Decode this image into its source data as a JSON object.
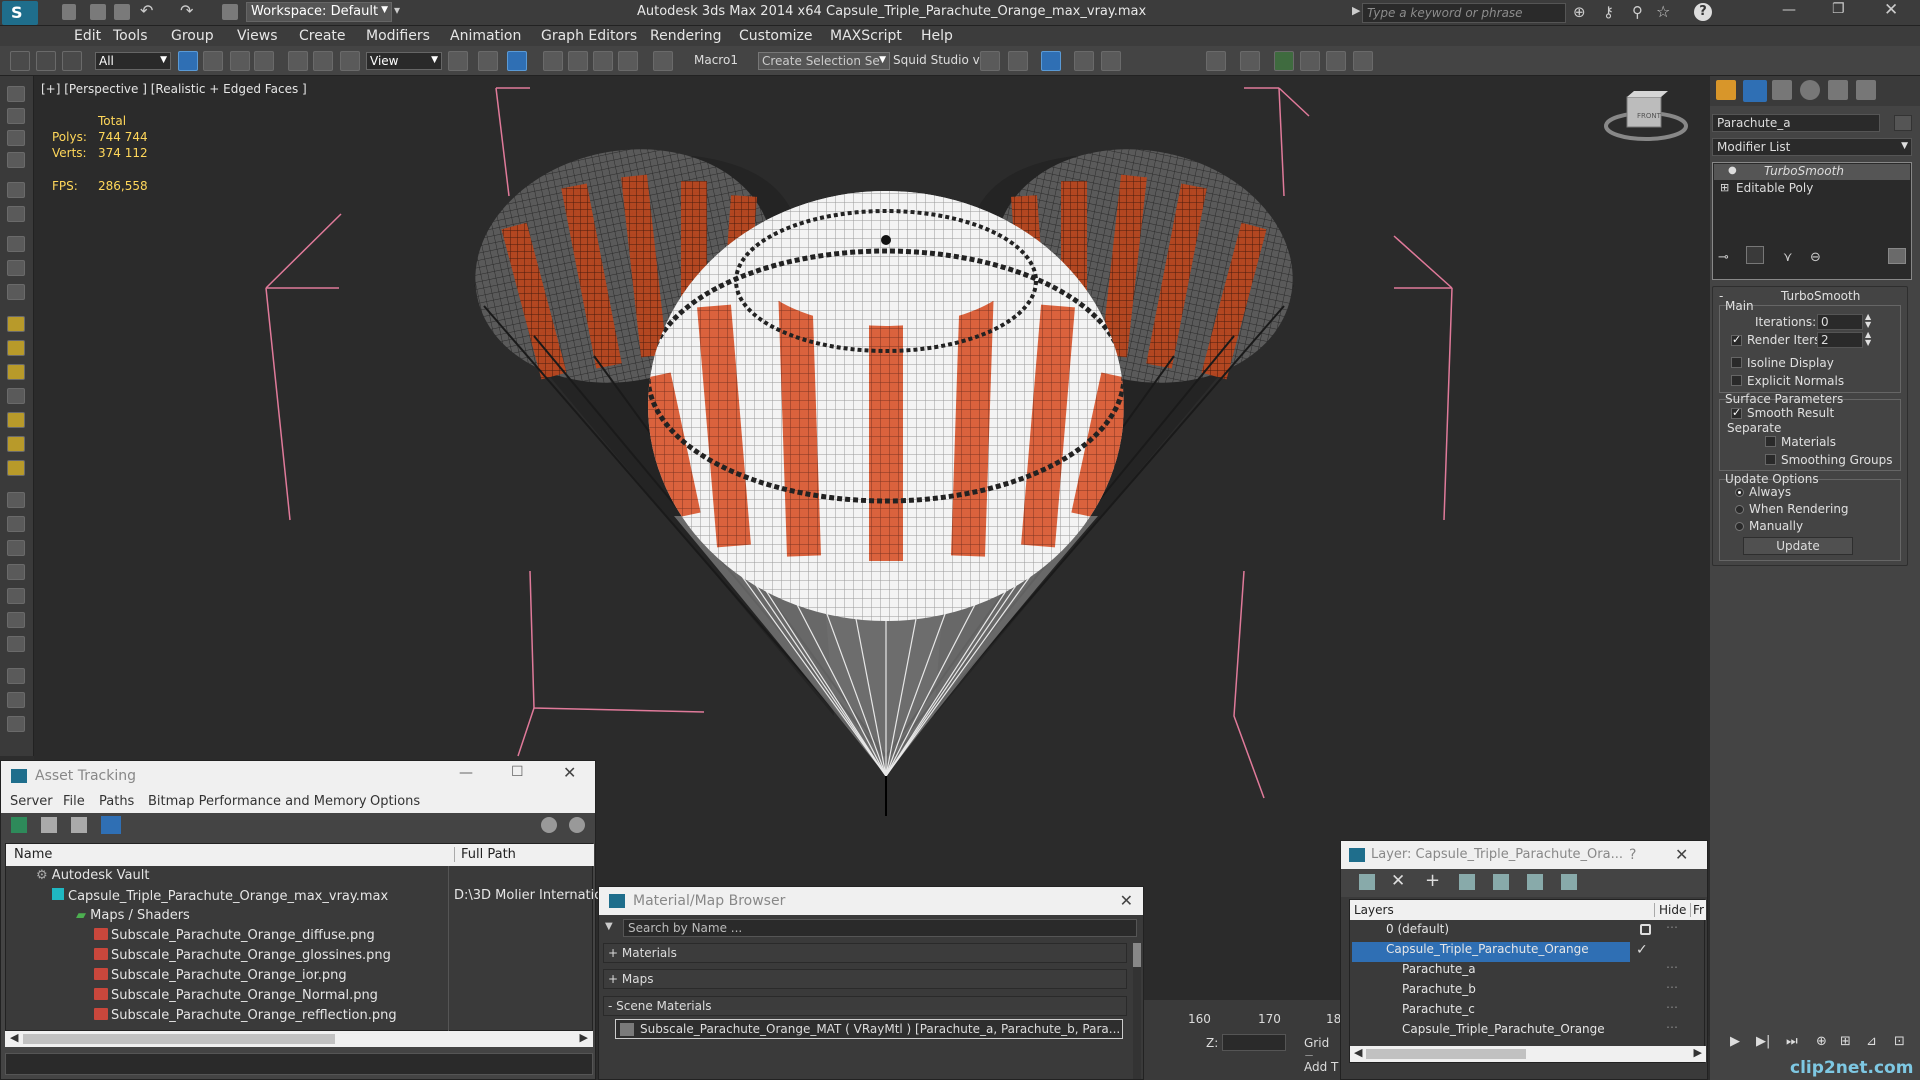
{
  "titlebar": {
    "workspace": "Workspace: Default",
    "app_title": "Autodesk 3ds Max  2014 x64",
    "file_title": "Capsule_Triple_Parachute_Orange_max_vray.max",
    "search_placeholder": "Type a keyword or phrase"
  },
  "menu": [
    "Edit",
    "Tools",
    "Group",
    "Views",
    "Create",
    "Modifiers",
    "Animation",
    "Graph Editors",
    "Rendering",
    "Customize",
    "MAXScript",
    "Help"
  ],
  "toolbar": {
    "filter": "All",
    "refcoord": "View",
    "macro": "Macro1",
    "selection_set": "Create Selection Se",
    "squid": "Squid Studio v"
  },
  "viewport": {
    "label": "[+] [Perspective ] [Realistic + Edged Faces ]",
    "stats_header": "Total",
    "polys_label": "Polys:",
    "polys": "744 744",
    "verts_label": "Verts:",
    "verts": "374 112",
    "fps_label": "FPS:",
    "fps": "286,558",
    "viewcube": "FRONT"
  },
  "cmdpanel": {
    "object_name": "Parachute_a",
    "modifier_list": "Modifier List",
    "stack": [
      "TurboSmooth",
      "Editable Poly"
    ],
    "rollout_title": "TurboSmooth",
    "main_label": "Main",
    "iterations_label": "Iterations:",
    "iterations": "0",
    "render_iters_label": "Render Iters:",
    "render_iters": "2",
    "isoline": "Isoline Display",
    "explicit": "Explicit Normals",
    "surface_params": "Surface Parameters",
    "smooth_result": "Smooth Result",
    "separate": "Separate",
    "materials": "Materials",
    "smoothing_groups": "Smoothing Groups",
    "update_options": "Update Options",
    "always": "Always",
    "when_rendering": "When Rendering",
    "manually": "Manually",
    "update_button": "Update"
  },
  "asset_tracking": {
    "title": "Asset Tracking",
    "menu": [
      "Server",
      "File",
      "Paths",
      "Bitmap Performance and Memory",
      "Options"
    ],
    "col_name": "Name",
    "col_path": "Full Path",
    "vault": "Autodesk Vault",
    "file": "Capsule_Triple_Parachute_Orange_max_vray.max",
    "file_path": "D:\\3D Molier Internatio",
    "maps": "Maps / Shaders",
    "textures": [
      "Subscale_Parachute_Orange_diffuse.png",
      "Subscale_Parachute_Orange_glossines.png",
      "Subscale_Parachute_Orange_ior.png",
      "Subscale_Parachute_Orange_Normal.png",
      "Subscale_Parachute_Orange_refflection.png"
    ]
  },
  "material_browser": {
    "title": "Material/Map Browser",
    "search_placeholder": "Search by Name ...",
    "materials": "+ Materials",
    "maps": "+ Maps",
    "scene_materials": "- Scene Materials",
    "item": "Subscale_Parachute_Orange_MAT  ( VRayMtl )  [Parachute_a, Parachute_b, Para..."
  },
  "layers": {
    "title": "Layer: Capsule_Triple_Parachute_Ora...",
    "help": "?",
    "col_layers": "Layers",
    "col_hide": "Hide",
    "col_fr": "Fr",
    "rows": [
      "0 (default)",
      "Capsule_Triple_Parachute_Orange",
      "Parachute_a",
      "Parachute_b",
      "Parachute_c",
      "Capsule_Triple_Parachute_Orange"
    ]
  },
  "timeline": {
    "ticks": [
      "160",
      "170",
      "18"
    ],
    "z_label": "Z:",
    "grid_label": "Grid =",
    "add_label": "Add T"
  },
  "watermark": "clip2net.com",
  "colors": {
    "accent": "#2f6fb4",
    "orange": "#d8532a",
    "stats": "#ffd75a"
  }
}
